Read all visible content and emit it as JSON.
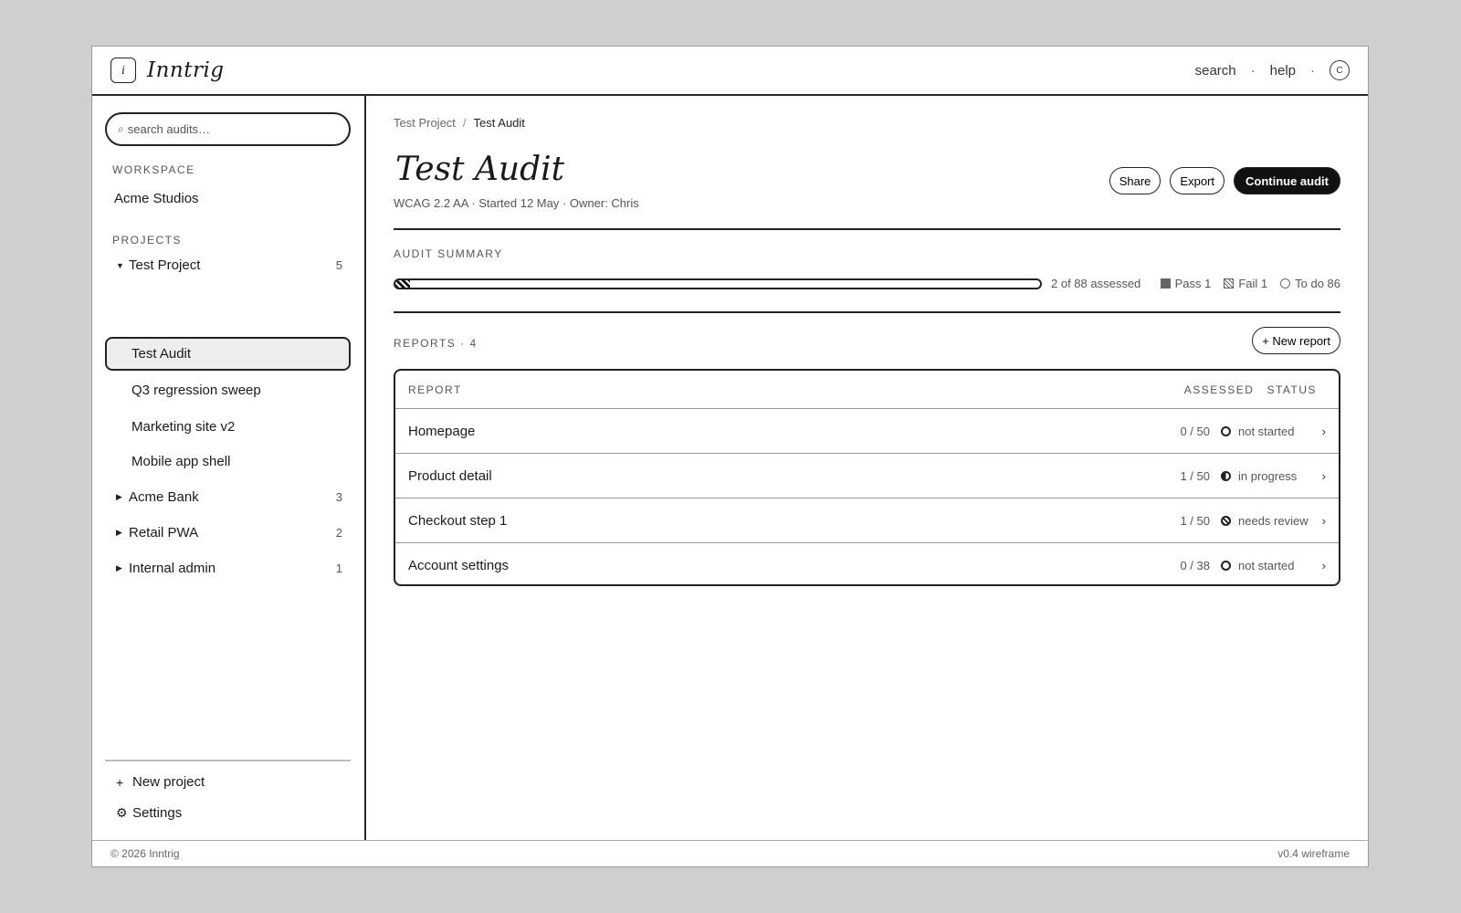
{
  "app": {
    "name": "Inntrig",
    "logo_letter": "i"
  },
  "topnav": {
    "search": "search",
    "help": "help",
    "separator": "·",
    "avatar_initial": "C"
  },
  "sidebar": {
    "search_placeholder": "search audits…",
    "search_icon": "⌕",
    "workspace_label": "WORKSPACE",
    "workspace_name": "Acme Studios",
    "projects_label": "PROJECTS",
    "projects": [
      {
        "name": "Test Project",
        "count": "5",
        "expanded": true,
        "icon": "chevron-down-icon"
      },
      {
        "name": "Acme Bank",
        "count": "3",
        "expanded": false,
        "icon": "chevron-right-icon"
      },
      {
        "name": "Retail PWA",
        "count": "2",
        "expanded": false,
        "icon": "chevron-right-icon"
      },
      {
        "name": "Internal admin",
        "count": "1",
        "expanded": false,
        "icon": "chevron-right-icon"
      }
    ],
    "audits": [
      "Test Audit",
      "Q3 regression sweep",
      "Marketing site v2",
      "Mobile app shell"
    ],
    "new_project": "New project",
    "settings": "Settings"
  },
  "main": {
    "breadcrumb": {
      "parent": "Test Project",
      "separator": "/",
      "current": "Test Audit"
    },
    "title": "Test Audit",
    "meta": "WCAG 2.2 AA · Started 12 May · Owner: Chris",
    "actions": {
      "share": "Share",
      "export": "Export",
      "continue": "Continue audit"
    },
    "summary": {
      "label": "AUDIT SUMMARY",
      "assessed_text": "2 of 88 assessed",
      "progress_fraction": 0.0227,
      "legend": {
        "pass": "Pass 1",
        "fail": "Fail 1",
        "todo": "To do 86"
      }
    },
    "reports": {
      "label": "REPORTS · 4",
      "new_report": "+ New report",
      "columns": {
        "report": "REPORT",
        "assessed": "ASSESSED",
        "status": "STATUS"
      },
      "rows": [
        {
          "name": "Homepage",
          "assessed": "0 / 50",
          "status": "not started",
          "status_icon": "empty-circle-icon"
        },
        {
          "name": "Product detail",
          "assessed": "1 / 50",
          "status": "in progress",
          "status_icon": "half-circle-icon"
        },
        {
          "name": "Checkout step 1",
          "assessed": "1 / 50",
          "status": "needs review",
          "status_icon": "hatched-circle-icon"
        },
        {
          "name": "Account settings",
          "assessed": "0 / 38",
          "status": "not started",
          "status_icon": "empty-circle-icon"
        }
      ]
    }
  },
  "footer": {
    "copyright": "© 2026 Inntrig",
    "version": "v0.4 wireframe"
  }
}
